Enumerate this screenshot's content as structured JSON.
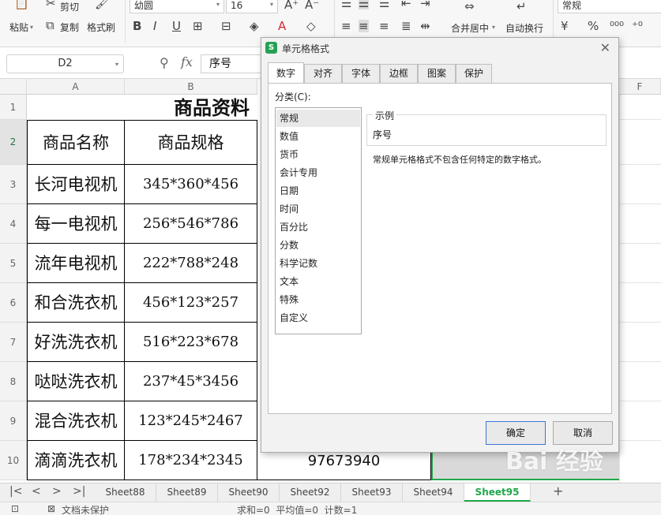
{
  "ribbon": {
    "paste": "粘贴",
    "cut": "剪切",
    "copy": "复制",
    "format_painter": "格式刷",
    "font_name": "幼圆",
    "font_size": "16",
    "merge_center": "合并居中",
    "wrap_text": "自动换行",
    "number_format": "常规"
  },
  "formula_bar": {
    "name_box": "D2",
    "fx": "fx",
    "content": "序号"
  },
  "sheet": {
    "columns": [
      "A",
      "B",
      "F"
    ],
    "rows": [
      "1",
      "2",
      "3",
      "4",
      "5",
      "6",
      "7",
      "8",
      "9",
      "10"
    ],
    "title": "商品资料",
    "headers": [
      "商品名称",
      "商品规格"
    ],
    "data": [
      {
        "name": "长河电视机",
        "spec": "345*360*456"
      },
      {
        "name": "每一电视机",
        "spec": "256*546*786"
      },
      {
        "name": "流年电视机",
        "spec": "222*788*248"
      },
      {
        "name": "和合洗衣机",
        "spec": "456*123*257"
      },
      {
        "name": "好洗洗衣机",
        "spec": "516*223*678"
      },
      {
        "name": "哒哒洗衣机",
        "spec": "237*45*3456"
      },
      {
        "name": "混合洗衣机",
        "spec": "123*245*2467"
      },
      {
        "name": "滴滴洗衣机",
        "spec": "178*234*2345"
      }
    ],
    "row10_d": "97673940"
  },
  "tabs": [
    "Sheet88",
    "Sheet89",
    "Sheet90",
    "Sheet92",
    "Sheet93",
    "Sheet94",
    "Sheet95"
  ],
  "active_tab": "Sheet95",
  "status": {
    "protect": "文档未保护",
    "summary": "求和=0  平均值=0  计数=1"
  },
  "dialog": {
    "title": "单元格格式",
    "logo": "S",
    "tabs": [
      "数字",
      "对齐",
      "字体",
      "边框",
      "图案",
      "保护"
    ],
    "category_label": "分类(C):",
    "categories": [
      "常规",
      "数值",
      "货币",
      "会计专用",
      "日期",
      "时间",
      "百分比",
      "分数",
      "科学记数",
      "文本",
      "特殊",
      "自定义"
    ],
    "selected_category": "常规",
    "sample_label": "示例",
    "sample_value": "序号",
    "description": "常规单元格格式不包含任何特定的数字格式。",
    "ok": "确定",
    "cancel": "取消"
  },
  "watermark": "Bai 经验",
  "colors": {
    "accent": "#20a84a",
    "grid_border": "#000000",
    "ok_border": "#3b78d8"
  }
}
